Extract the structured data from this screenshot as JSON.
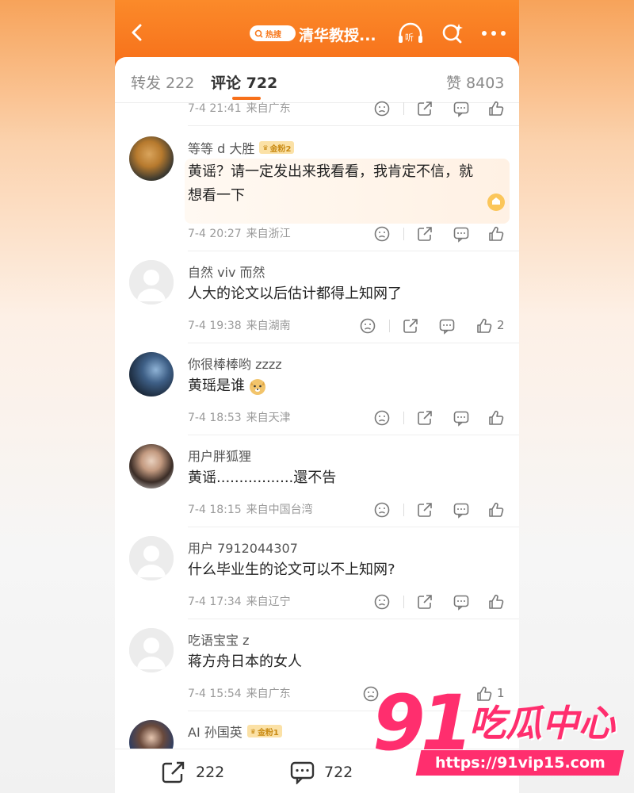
{
  "header": {
    "search_pill": "热搜",
    "title": "清华教授...",
    "listen_label": "听"
  },
  "tabs": {
    "repost": "转发 222",
    "comments": "评论 722",
    "likes": "赞 8403"
  },
  "comments": [
    {
      "time": "7-4 21:41",
      "location": "来自广东"
    },
    {
      "user": "等等 d 大胜",
      "badge": "金粉2",
      "text_line1": "黄谣？请一定发出来我看看，我肯定不信，就",
      "text_line2": "想看一下",
      "time": "7-4 20:27",
      "location": "来自浙江"
    },
    {
      "user": "自然 viv 而然",
      "text": "人大的论文以后估计都得上知网了",
      "time": "7-4 19:38",
      "location": "来自湖南",
      "likes": "2"
    },
    {
      "user": "你很棒棒哟 zzzz",
      "text": "黄瑶是谁",
      "time": "7-4 18:53",
      "location": "来自天津"
    },
    {
      "user": "用户胖狐狸",
      "text": "黄谣.................還不告",
      "time": "7-4 18:15",
      "location": "来自中国台湾"
    },
    {
      "user": "用户 7912044307",
      "text": "什么毕业生的论文可以不上知网?",
      "time": "7-4 17:34",
      "location": "来自辽宁"
    },
    {
      "user": "吃语宝宝 z",
      "text": "蒋方舟日本的女人",
      "time": "7-4 15:54",
      "location": "来自广东",
      "likes": "1"
    },
    {
      "user": "AI 孙国英",
      "badge": "金粉1"
    }
  ],
  "bottom_bar": {
    "repost_count": "222",
    "comment_count": "722"
  },
  "watermark": {
    "logo_number": "91",
    "logo_text": "吃瓜中心",
    "url": "https://91vip15.com"
  },
  "colors": {
    "brand_orange": "#f7701a",
    "watermark_pink": "#ff2e6e",
    "badge_gold": "#fbe1a6"
  }
}
